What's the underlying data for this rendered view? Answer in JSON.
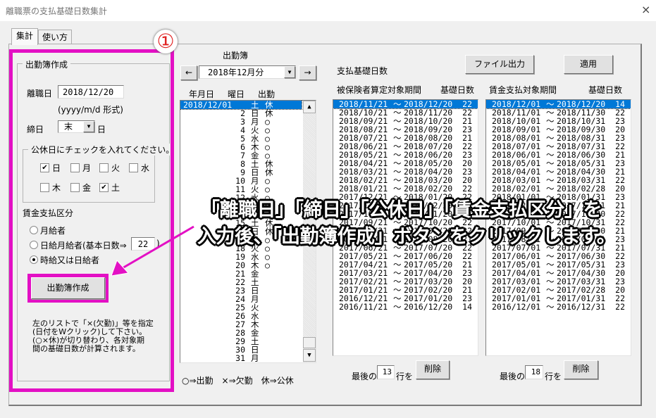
{
  "window": {
    "title": "離職票の支払基礎日数集計",
    "close_symbol": "×"
  },
  "tabs": [
    {
      "label": "集計",
      "active": true
    },
    {
      "label": "使い方",
      "active": false
    }
  ],
  "callout_number": "①",
  "left_panel": {
    "group_title": "出勤簿作成",
    "retire_date_label": "離職日",
    "retire_date_value": "2018/12/20",
    "date_format_hint": "(yyyy/m/d 形式)",
    "closing_day_label": "締日",
    "closing_day_value": "末",
    "closing_day_suffix": "日",
    "holiday_group_title": "公休日にチェックを入れてください。",
    "holidays": [
      {
        "label": "日",
        "checked": true
      },
      {
        "label": "月",
        "checked": false
      },
      {
        "label": "火",
        "checked": false
      },
      {
        "label": "水",
        "checked": false
      },
      {
        "label": "木",
        "checked": false
      },
      {
        "label": "金",
        "checked": false
      },
      {
        "label": "土",
        "checked": true
      }
    ],
    "wage_type_label": "賃金支払区分",
    "wage_types": [
      {
        "label": "月給者",
        "selected": false
      },
      {
        "label": "日給月給者(基本日数⇒",
        "selected": false
      },
      {
        "label": "時給又は日給者",
        "selected": true
      }
    ],
    "base_days_value": "22",
    "base_days_close": ")",
    "create_button": "出勤簿作成",
    "note": "左のリストで「×(欠勤)」等を指定\n(日付をWクリック)して下さい。\n(○×休)が切り替わり、各対象期\n間の基礎日数が計算されます。",
    "check_mark": "✔"
  },
  "attendance": {
    "title": "出勤簿",
    "prev_button": "←",
    "next_button": "→",
    "month_value": "2018年12月分",
    "headers": [
      "年月日",
      "曜日",
      "出勤"
    ],
    "rows": [
      [
        "2018/12/01",
        "土",
        "休"
      ],
      [
        "2",
        "日",
        "休"
      ],
      [
        "3",
        "月",
        "○"
      ],
      [
        "4",
        "火",
        "○"
      ],
      [
        "5",
        "水",
        "○"
      ],
      [
        "6",
        "木",
        "○"
      ],
      [
        "7",
        "金",
        "○"
      ],
      [
        "8",
        "土",
        "休"
      ],
      [
        "9",
        "日",
        "休"
      ],
      [
        "10",
        "月",
        "○"
      ],
      [
        "11",
        "火",
        "○"
      ],
      [
        "12",
        "水",
        "○"
      ],
      [
        "13",
        "木",
        "○"
      ],
      [
        "14",
        "金",
        "○"
      ],
      [
        "15",
        "土",
        "休"
      ],
      [
        "16",
        "日",
        "休"
      ],
      [
        "17",
        "月",
        "○"
      ],
      [
        "18",
        "火",
        "○"
      ],
      [
        "19",
        "水",
        "○"
      ],
      [
        "20",
        "木",
        "○"
      ],
      [
        "21",
        "金",
        ""
      ],
      [
        "22",
        "土",
        ""
      ],
      [
        "23",
        "日",
        ""
      ],
      [
        "24",
        "月",
        ""
      ],
      [
        "25",
        "火",
        ""
      ],
      [
        "26",
        "水",
        ""
      ],
      [
        "27",
        "木",
        ""
      ],
      [
        "28",
        "金",
        ""
      ],
      [
        "29",
        "土",
        ""
      ],
      [
        "30",
        "日",
        ""
      ],
      [
        "31",
        "月",
        ""
      ]
    ],
    "selected_index": 0,
    "legend": "○⇒出勤　×⇒欠勤　休⇒公休"
  },
  "basis_days": {
    "title": "支払基礎日数",
    "file_output_button": "ファイル出力",
    "apply_button": "適用",
    "insured": {
      "header_period": "被保険者算定対象期間",
      "header_days": "基礎日数",
      "rows": [
        [
          "2018/11/21",
          "2018/12/20",
          "22"
        ],
        [
          "2018/10/21",
          "2018/11/20",
          "22"
        ],
        [
          "2018/09/21",
          "2018/10/20",
          "21"
        ],
        [
          "2018/08/21",
          "2018/09/20",
          "23"
        ],
        [
          "2018/07/21",
          "2018/08/20",
          "21"
        ],
        [
          "2018/06/21",
          "2018/07/20",
          "22"
        ],
        [
          "2018/05/21",
          "2018/06/20",
          "23"
        ],
        [
          "2018/04/21",
          "2018/05/20",
          "20"
        ],
        [
          "2018/03/21",
          "2018/04/20",
          "23"
        ],
        [
          "2018/02/21",
          "2018/03/20",
          "20"
        ],
        [
          "2018/01/21",
          "2018/02/20",
          "22"
        ],
        [
          "2017/12/21",
          "2018/01/20",
          "22"
        ],
        [
          "2017/11/21",
          "2017/12/20",
          "22"
        ],
        [
          "2017/10/21",
          "2017/11/20",
          "21"
        ],
        [
          "2017/09/21",
          "2017/10/20",
          "22"
        ],
        [
          "2017/08/21",
          "2017/09/20",
          "22"
        ],
        [
          "2017/07/21",
          "2017/08/20",
          "21"
        ],
        [
          "2017/06/21",
          "2017/07/20",
          "22"
        ],
        [
          "2017/05/21",
          "2017/06/20",
          "22"
        ],
        [
          "2017/04/21",
          "2017/05/20",
          "21"
        ],
        [
          "2017/03/21",
          "2017/04/20",
          "23"
        ],
        [
          "2017/02/21",
          "2017/03/20",
          "20"
        ],
        [
          "2017/01/21",
          "2017/02/20",
          "21"
        ],
        [
          "2016/12/21",
          "2017/01/20",
          "23"
        ],
        [
          "2016/11/21",
          "2016/12/20",
          "14"
        ]
      ],
      "delete_prefix": "最後の",
      "delete_count": "13",
      "delete_suffix": "行を",
      "delete_button": "削除"
    },
    "wage": {
      "header_period": "賃金支払対象期間",
      "header_days": "基礎日数",
      "rows": [
        [
          "2018/12/01",
          "2018/12/20",
          "14"
        ],
        [
          "2018/11/01",
          "2018/11/30",
          "22"
        ],
        [
          "2018/10/01",
          "2018/10/31",
          "23"
        ],
        [
          "2018/09/01",
          "2018/09/30",
          "20"
        ],
        [
          "2018/08/01",
          "2018/08/31",
          "23"
        ],
        [
          "2018/07/01",
          "2018/07/31",
          "22"
        ],
        [
          "2018/06/01",
          "2018/06/30",
          "21"
        ],
        [
          "2018/05/01",
          "2018/05/31",
          "23"
        ],
        [
          "2018/04/01",
          "2018/04/30",
          "21"
        ],
        [
          "2018/03/01",
          "2018/03/31",
          "22"
        ],
        [
          "2018/02/01",
          "2018/02/28",
          "20"
        ],
        [
          "2018/01/01",
          "2018/01/31",
          "23"
        ],
        [
          "2017/12/01",
          "2017/12/31",
          "21"
        ],
        [
          "2017/11/01",
          "2017/11/30",
          "22"
        ],
        [
          "2017/10/01",
          "2017/10/31",
          "22"
        ],
        [
          "2017/09/01",
          "2017/09/30",
          "21"
        ],
        [
          "2017/08/01",
          "2017/08/31",
          "23"
        ],
        [
          "2017/07/01",
          "2017/07/31",
          "21"
        ],
        [
          "2017/06/01",
          "2017/06/30",
          "22"
        ],
        [
          "2017/05/01",
          "2017/05/31",
          "23"
        ],
        [
          "2017/04/01",
          "2017/04/30",
          "20"
        ],
        [
          "2017/03/01",
          "2017/03/31",
          "23"
        ],
        [
          "2017/02/01",
          "2017/02/28",
          "20"
        ],
        [
          "2017/01/01",
          "2017/01/31",
          "22"
        ],
        [
          "2016/12/01",
          "2016/12/31",
          "22"
        ]
      ],
      "delete_prefix": "最後の",
      "delete_count": "18",
      "delete_suffix": "行を",
      "delete_button": "削除"
    },
    "tilde": "〜"
  },
  "annotation": {
    "line1": "「離職日」「締日」「公休日」「賃金支払区分」を",
    "line2": "入力後、「出勤簿作成」ボタンをクリックします。",
    "color": "#e310c4"
  }
}
